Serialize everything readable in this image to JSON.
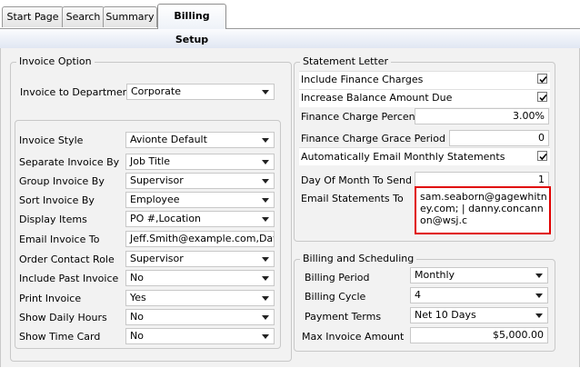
{
  "tabs": [
    {
      "label": "Start Page"
    },
    {
      "label": "Search"
    },
    {
      "label": "Summary"
    },
    {
      "label": "Billing Setup"
    }
  ],
  "invoice_option": {
    "legend": "Invoice Option",
    "invoice_to_department": {
      "label": "Invoice to Department",
      "value": "Corporate"
    },
    "fields": [
      {
        "label": "Invoice Style",
        "value": "Avionte Default"
      },
      {
        "label": "Separate Invoice By",
        "value": "Job Title"
      },
      {
        "label": "Group Invoice By",
        "value": "Supervisor"
      },
      {
        "label": "Sort Invoice By",
        "value": "Employee"
      },
      {
        "label": "Display Items",
        "value": "PO #,Location"
      },
      {
        "label": "Email Invoice To",
        "value": "Jeff.Smith@example.com,Dave."
      },
      {
        "label": "Order Contact Role",
        "value": "Supervisor"
      },
      {
        "label": "Include Past Invoice",
        "value": "No"
      },
      {
        "label": "Print Invoice",
        "value": "Yes"
      },
      {
        "label": "Show Daily Hours",
        "value": "No"
      },
      {
        "label": "Show Time Card",
        "value": "No"
      }
    ]
  },
  "statement_letter": {
    "legend": "Statement Letter",
    "include_finance_charges": {
      "label": "Include Finance Charges",
      "checked": true
    },
    "increase_balance_amount_due": {
      "label": "Increase Balance Amount Due",
      "checked": true
    },
    "finance_charge_percent": {
      "label": "Finance Charge Percent",
      "value": "3.00%"
    },
    "finance_charge_grace_period": {
      "label": "Finance Charge Grace Period",
      "value": "0"
    },
    "auto_email_statements": {
      "label": "Automatically Email Monthly Statements",
      "checked": true
    },
    "day_of_month_to_send": {
      "label": "Day Of Month To Send",
      "value": "1"
    },
    "email_statements_to": {
      "label": "Email Statements To",
      "value": "sam.seaborn@gagewhitney.com; | danny.concannon@wsj.c"
    }
  },
  "billing_scheduling": {
    "legend": "Billing and Scheduling",
    "billing_period": {
      "label": "Billing Period",
      "value": "Monthly"
    },
    "billing_cycle": {
      "label": "Billing Cycle",
      "value": "4"
    },
    "payment_terms": {
      "label": "Payment Terms",
      "value": "Net 10 Days"
    },
    "max_invoice_amount": {
      "label": "Max Invoice Amount",
      "value": "$5,000.00"
    }
  },
  "colors": {
    "highlight": "#e00000",
    "band": "#dfe6f2",
    "panel": "#f2f2f2"
  }
}
